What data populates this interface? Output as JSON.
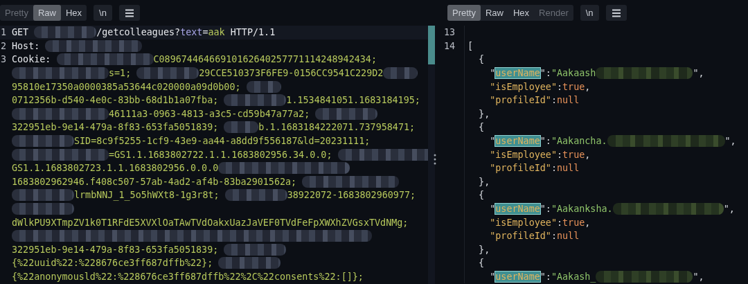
{
  "request_pane": {
    "tabs": [
      {
        "label": "Pretty",
        "selected": false,
        "disabled": true
      },
      {
        "label": "Raw",
        "selected": true,
        "disabled": false
      },
      {
        "label": "Hex",
        "selected": false,
        "disabled": false
      }
    ],
    "newline_button": "\\n",
    "lines": [
      {
        "number": "1",
        "tokens": [
          {
            "kind": "plain",
            "text": "GET "
          },
          {
            "kind": "redacted"
          },
          {
            "kind": "plain",
            "text": "/getcolleagues?"
          },
          {
            "kind": "param",
            "text": "text"
          },
          {
            "kind": "plain",
            "text": "="
          },
          {
            "kind": "value",
            "text": "aak"
          },
          {
            "kind": "plain",
            "text": " HTTP/1.1"
          }
        ]
      },
      {
        "number": "2",
        "tokens": [
          {
            "kind": "plain",
            "text": "Host: "
          },
          {
            "kind": "redacted"
          }
        ]
      },
      {
        "number": "3",
        "tokens": [
          {
            "kind": "plain",
            "text": "Cookie: "
          },
          {
            "kind": "redacted"
          },
          {
            "kind": "value",
            "text": "C08967446466910162640257771114248942434;"
          }
        ]
      },
      {
        "tokens": [
          {
            "kind": "redacted"
          },
          {
            "kind": "value",
            "text": "s=1; "
          },
          {
            "kind": "redacted"
          },
          {
            "kind": "value",
            "text": "29CCE510373F6FE9-0156CC9541C229D2"
          },
          {
            "kind": "redacted"
          }
        ]
      },
      {
        "tokens": [
          {
            "kind": "value",
            "text": "95810e17350a0000385a53644c020000a09d0b00; "
          },
          {
            "kind": "redacted"
          }
        ]
      },
      {
        "tokens": [
          {
            "kind": "value",
            "text": "0712356b-d540-4e0c-83bb-68d1b1a07fba; "
          },
          {
            "kind": "redacted"
          },
          {
            "kind": "value",
            "text": "1.1534841051.1683184195;"
          }
        ]
      },
      {
        "tokens": [
          {
            "kind": "redacted"
          },
          {
            "kind": "value",
            "text": "46111a3-0963-4813-a3c5-cd59b47a77a2; "
          },
          {
            "kind": "redacted"
          }
        ]
      },
      {
        "tokens": [
          {
            "kind": "value",
            "text": "322951eb-9e14-479a-8f83-653fa5051839; "
          },
          {
            "kind": "redacted"
          },
          {
            "kind": "value",
            "text": "b.1.1683184222071.737958471;"
          }
        ]
      },
      {
        "tokens": [
          {
            "kind": "redacted"
          },
          {
            "kind": "value",
            "text": "SID=8c9f5255-1cf9-43e9-aa44-a8dd9f556187&ld=20231111;"
          }
        ]
      },
      {
        "tokens": [
          {
            "kind": "redacted"
          },
          {
            "kind": "value",
            "text": "=GS1.1.1683802722.1.1.1683802956.34.0.0; "
          },
          {
            "kind": "redacted"
          }
        ]
      },
      {
        "tokens": [
          {
            "kind": "value",
            "text": "GS1.1.1683802723.1.1.1683802956.0.0.0"
          },
          {
            "kind": "redacted"
          }
        ]
      },
      {
        "tokens": [
          {
            "kind": "value",
            "text": "1683802962946.f408c507-57ab-4ad2-af4b-83ba2901562a; "
          },
          {
            "kind": "redacted"
          }
        ]
      },
      {
        "tokens": [
          {
            "kind": "redacted"
          },
          {
            "kind": "value",
            "text": "lrmbNNJ_1_5o5hWXt8-1g3r8t; "
          },
          {
            "kind": "redacted"
          },
          {
            "kind": "value",
            "text": "38922072-1683802960977;"
          }
        ]
      },
      {
        "tokens": [
          {
            "kind": "redacted"
          }
        ]
      },
      {
        "tokens": [
          {
            "kind": "value",
            "text": "dWlkPU9XTmpZV1k0T1RFdE5XVXlOaTAwTVdOakxUazJaVEF0TVdFeFpXWXhZVGsxTVdNMg;"
          }
        ]
      },
      {
        "tokens": [
          {
            "kind": "redacted"
          }
        ]
      },
      {
        "tokens": [
          {
            "kind": "value",
            "text": "322951eb-9e14-479a-8f83-653fa5051839; "
          },
          {
            "kind": "redacted"
          }
        ]
      },
      {
        "tokens": [
          {
            "kind": "value",
            "text": "{%22uuid%22:%228676ce3ff687dffb%22}; "
          },
          {
            "kind": "redacted"
          }
        ]
      },
      {
        "tokens": [
          {
            "kind": "value",
            "text": "{%22anonymousld%22:%228676ce3ff687dffb%22%2C%22consents%22:[]};"
          }
        ]
      }
    ]
  },
  "response_pane": {
    "tabs": [
      {
        "label": "Pretty",
        "selected": true,
        "disabled": false
      },
      {
        "label": "Raw",
        "selected": false,
        "disabled": false
      },
      {
        "label": "Hex",
        "selected": false,
        "disabled": false
      },
      {
        "label": "Render",
        "selected": false,
        "disabled": true
      }
    ],
    "newline_button": "\\n",
    "lines": [
      {
        "number": "13"
      },
      {
        "number": "14",
        "tokens": [
          {
            "kind": "punct",
            "text": "["
          }
        ]
      },
      {
        "tokens": [
          {
            "kind": "punct",
            "text": "  {"
          }
        ]
      },
      {
        "tokens": [
          {
            "kind": "punct",
            "text": "    \""
          },
          {
            "kind": "match",
            "text": "userName"
          },
          {
            "kind": "punct",
            "text": "\":"
          },
          {
            "kind": "string",
            "text": "\"Aakaash"
          },
          {
            "kind": "redacted"
          },
          {
            "kind": "punct",
            "text": "\","
          }
        ]
      },
      {
        "tokens": [
          {
            "kind": "key",
            "text": "    \"isEmployee\""
          },
          {
            "kind": "punct",
            "text": ":"
          },
          {
            "kind": "literal",
            "text": "true"
          },
          {
            "kind": "punct",
            "text": ","
          }
        ]
      },
      {
        "tokens": [
          {
            "kind": "key",
            "text": "    \"profileId\""
          },
          {
            "kind": "punct",
            "text": ":"
          },
          {
            "kind": "literal",
            "text": "null"
          }
        ]
      },
      {
        "tokens": [
          {
            "kind": "punct",
            "text": "  },"
          }
        ]
      },
      {
        "tokens": [
          {
            "kind": "punct",
            "text": "  {"
          }
        ]
      },
      {
        "tokens": [
          {
            "kind": "punct",
            "text": "    \""
          },
          {
            "kind": "match",
            "text": "userName"
          },
          {
            "kind": "punct",
            "text": "\":"
          },
          {
            "kind": "string",
            "text": "\"Aakancha."
          },
          {
            "kind": "redacted"
          },
          {
            "kind": "punct",
            "text": "\","
          }
        ]
      },
      {
        "tokens": [
          {
            "kind": "key",
            "text": "    \"isEmployee\""
          },
          {
            "kind": "punct",
            "text": ":"
          },
          {
            "kind": "literal",
            "text": "true"
          },
          {
            "kind": "punct",
            "text": ","
          }
        ]
      },
      {
        "tokens": [
          {
            "kind": "key",
            "text": "    \"profileId\""
          },
          {
            "kind": "punct",
            "text": ":"
          },
          {
            "kind": "literal",
            "text": "null"
          }
        ]
      },
      {
        "tokens": [
          {
            "kind": "punct",
            "text": "  },"
          }
        ]
      },
      {
        "tokens": [
          {
            "kind": "punct",
            "text": "  {"
          }
        ]
      },
      {
        "tokens": [
          {
            "kind": "punct",
            "text": "    \""
          },
          {
            "kind": "match",
            "text": "userName"
          },
          {
            "kind": "punct",
            "text": "\":"
          },
          {
            "kind": "string",
            "text": "\"Aakanksha."
          },
          {
            "kind": "redacted"
          },
          {
            "kind": "punct",
            "text": "\","
          }
        ]
      },
      {
        "tokens": [
          {
            "kind": "key",
            "text": "    \"isEmployee\""
          },
          {
            "kind": "punct",
            "text": ":"
          },
          {
            "kind": "literal",
            "text": "true"
          },
          {
            "kind": "punct",
            "text": ","
          }
        ]
      },
      {
        "tokens": [
          {
            "kind": "key",
            "text": "    \"profileId\""
          },
          {
            "kind": "punct",
            "text": ":"
          },
          {
            "kind": "literal",
            "text": "null"
          }
        ]
      },
      {
        "tokens": [
          {
            "kind": "punct",
            "text": "  },"
          }
        ]
      },
      {
        "tokens": [
          {
            "kind": "punct",
            "text": "  {"
          }
        ]
      },
      {
        "tokens": [
          {
            "kind": "punct",
            "text": "    \""
          },
          {
            "kind": "match",
            "text": "userName"
          },
          {
            "kind": "punct",
            "text": "\":"
          },
          {
            "kind": "string",
            "text": "\"Aakash_"
          },
          {
            "kind": "redacted"
          },
          {
            "kind": "punct",
            "text": "\","
          }
        ]
      }
    ]
  }
}
